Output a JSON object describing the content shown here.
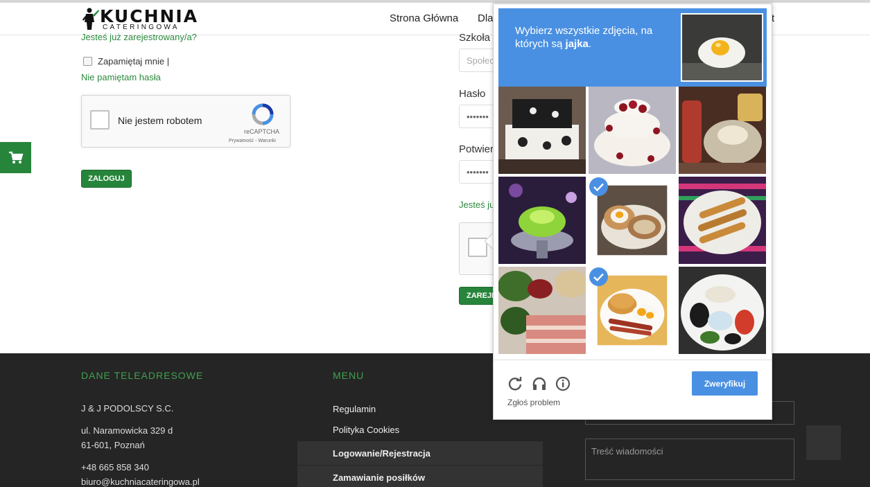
{
  "header": {
    "logo_main": "KUCHNIA",
    "logo_sub": "CATERINGOWA",
    "nav": [
      "Strona Główna",
      "Dla",
      "t"
    ]
  },
  "login": {
    "registered_link": "Jesteś już zarejestrowany/a?",
    "remember_label": "Zapamiętaj mnie |",
    "forgot_link": "Nie pamiętam hasła",
    "recaptcha_label": "Nie jestem robotem",
    "recaptcha_brand": "reCAPTCHA",
    "recaptcha_privacy": "Prywatność - Warunki",
    "login_button": "ZALOGUJ"
  },
  "register": {
    "school_label": "Szkoła",
    "school_placeholder": "Społec",
    "password_label": "Hasło",
    "password_value": "•••••••",
    "confirm_label": "Potwier",
    "confirm_value": "•••••••",
    "registered_link": "Jesteś ju",
    "register_button": "ZAREJE"
  },
  "captcha": {
    "instruction_prefix": "Wybierz wszystkie zdjęcia, na których są ",
    "instruction_target": "jajka",
    "instruction_suffix": ".",
    "report": "Zgłoś problem",
    "verify": "Zweryfikuj",
    "accent": "#4a90e2",
    "tiles": [
      {
        "subject": "black-white-cake",
        "selected": false
      },
      {
        "subject": "rose-wedding-cake",
        "selected": false
      },
      {
        "subject": "dessert-jars",
        "selected": false
      },
      {
        "subject": "green-jelly-dessert",
        "selected": false
      },
      {
        "subject": "egg-on-bread",
        "selected": true
      },
      {
        "subject": "chicken-skewers",
        "selected": false
      },
      {
        "subject": "salad-and-meat",
        "selected": false
      },
      {
        "subject": "pancakes-eggs-bacon",
        "selected": true
      },
      {
        "subject": "composed-salad",
        "selected": false
      }
    ]
  },
  "footer": {
    "contact_heading": "DANE TELEADRESOWE",
    "company": "J & J PODOLSCY S.C.",
    "street": "ul. Naramowicka 329 d",
    "city": "61-601, Poznań",
    "phone": "+48 665 858 340",
    "email": "biuro@kuchniacateringowa.pl",
    "menu_heading": "MENU",
    "menu_items": [
      "Regulamin",
      "Polityka Cookies",
      "Logowanie/Rejestracja",
      "Zamawianie posiłków"
    ],
    "message_placeholder": "Treść wiadomości"
  },
  "colors": {
    "brand_green": "#27853b",
    "footer_bg": "#252525"
  }
}
